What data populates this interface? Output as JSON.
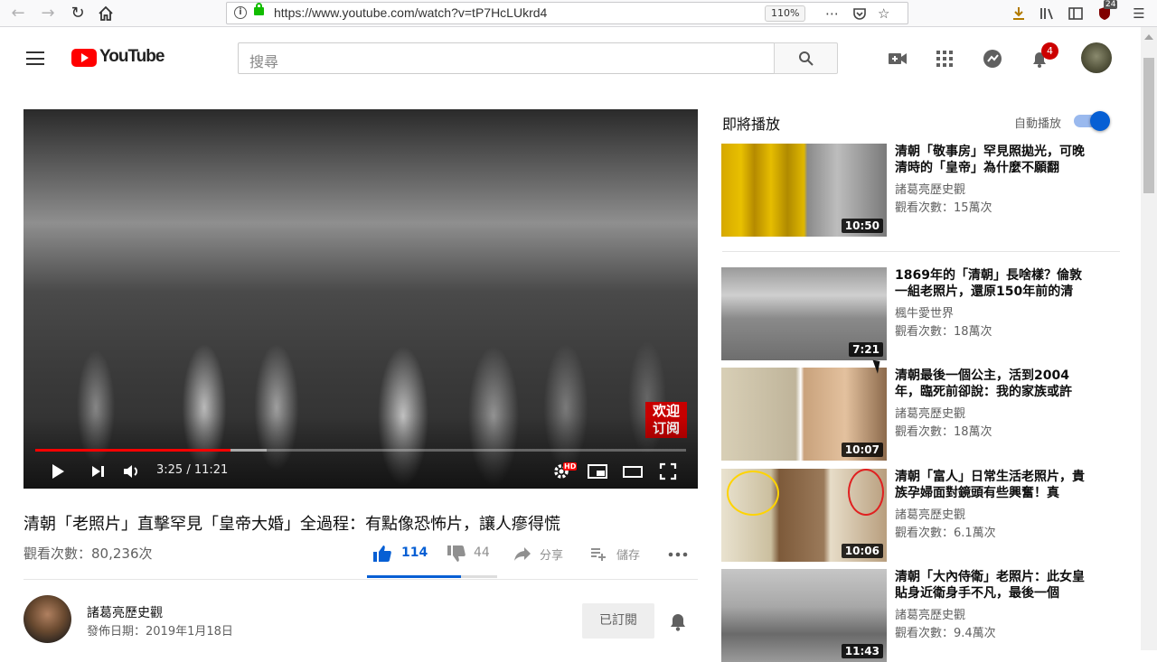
{
  "browser": {
    "url": "https://www.youtube.com/watch?v=tP7HcLUkrd4",
    "zoom": "110%",
    "ext_badge": "24"
  },
  "header": {
    "logo_text": "YouTube",
    "search_placeholder": "搜尋",
    "notification_count": "4"
  },
  "player": {
    "time": "3:25 / 11:21",
    "watermark": "欢迎\n订阅",
    "progress_played": 0.3,
    "progress_buffered": 0.355,
    "hd_badge": "HD"
  },
  "video": {
    "title": "清朝「老照片」直擊罕見「皇帝大婚」全過程：有點像恐怖片，讓人瘮得慌",
    "views": "觀看次數：80,236次",
    "likes": "114",
    "dislikes": "44",
    "share": "分享",
    "save": "儲存",
    "like_ratio": 0.72
  },
  "channel": {
    "name": "諸葛亮歷史觀",
    "published": "發佈日期：2019年1月18日",
    "subscribe_label": "已訂閱"
  },
  "sidebar": {
    "up_next": "即將播放",
    "autoplay": "自動播放",
    "autoplay_on": true,
    "items": [
      {
        "title": "清朝「敬事房」罕見照拋光，可晚清時的「皇帝」為什麼不願翻",
        "channel": "諸葛亮歷史觀",
        "views": "觀看次數：15萬次",
        "duration": "10:50"
      },
      {
        "title": "1869年的「清朝」長啥樣？倫敦一組老照片，還原150年前的清",
        "channel": "楓牛愛世界",
        "views": "觀看次數：18萬次",
        "duration": "7:21"
      },
      {
        "title": "清朝最後一個公主，活到2004年，臨死前卻說：我的家族或許",
        "channel": "諸葛亮歷史觀",
        "views": "觀看次數：18萬次",
        "duration": "10:07"
      },
      {
        "title": "清朝「富人」日常生活老照片，貴族孕婦面對鏡頭有些興奮！真",
        "channel": "諸葛亮歷史觀",
        "views": "觀看次數：6.1萬次",
        "duration": "10:06"
      },
      {
        "title": "清朝「大內侍衛」老照片：此女皇貼身近衛身手不凡，最後一個",
        "channel": "諸葛亮歷史觀",
        "views": "觀看次數：9.4萬次",
        "duration": "11:43"
      }
    ]
  }
}
